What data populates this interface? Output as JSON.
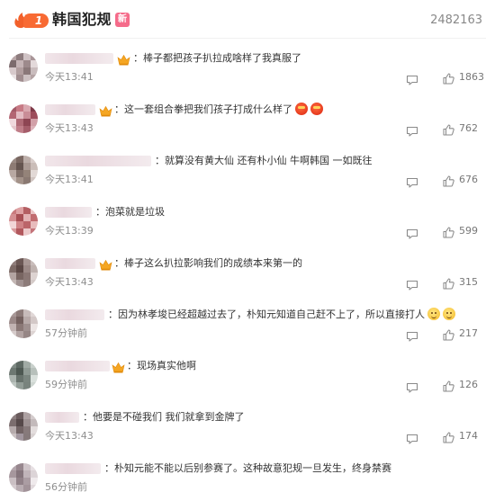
{
  "header": {
    "rank": "1",
    "title": "韩国犯规",
    "new_badge": "新",
    "hot_count": "2482163"
  },
  "comments": [
    {
      "text": "：棒子都把孩子扒拉成啥样了我真服了",
      "time": "今天13:41",
      "likes": "1863",
      "vip": true,
      "emojis": [],
      "avatar": [
        "#b9a7a8",
        "#8d7c7e",
        "#cfc2c4",
        "#a99598",
        "#7c6b6d",
        "#c4b3b5",
        "#9d8a8c",
        "#e3d9da",
        "#d7c9cb",
        "#b19e9f",
        "#8a7879",
        "#c9bcbd",
        "#ebe3e4",
        "#a08d8f",
        "#ccc0c1",
        "#b4a3a4"
      ]
    },
    {
      "text": "：这一套组合拳把我们孩子打成什么样了",
      "time": "今天13:43",
      "likes": "762",
      "vip": true,
      "emojis": [
        "red",
        "red"
      ],
      "avatar": [
        "#a35a67",
        "#c77a85",
        "#d9a8b0",
        "#7e3948",
        "#b36673",
        "#e3bcc3",
        "#c98d97",
        "#9c4c5a",
        "#f0d9dd",
        "#b06a76",
        "#8e4553",
        "#d2a0a8",
        "#e6c7cc",
        "#c07e89",
        "#a55d6a",
        "#dcb2b9"
      ]
    },
    {
      "text": "：就算没有黄大仙 还有朴小仙 牛啊韩国 一如既往",
      "time": "今天13:41",
      "likes": "676",
      "vip": false,
      "emojis": [],
      "avatar": [
        "#9a8a84",
        "#7a6862",
        "#bcaea9",
        "#d8cdca",
        "#8d7b74",
        "#655550",
        "#aa9a94",
        "#cabdb8",
        "#b8a8a2",
        "#7f6e68",
        "#948379",
        "#e2d9d6",
        "#c6b9b4",
        "#a39289",
        "#8a7972",
        "#d0c5c1"
      ]
    },
    {
      "text": "：泡菜就是垃圾",
      "time": "今天13:39",
      "likes": "599",
      "vip": false,
      "emojis": [],
      "avatar": [
        "#c97a7d",
        "#dea2a4",
        "#b45f63",
        "#eac4c5",
        "#d58f92",
        "#a84f54",
        "#e3b2b4",
        "#c16c70",
        "#f2d6d7",
        "#cf8386",
        "#bb6569",
        "#e8bcbd",
        "#d99a9c",
        "#b2585d",
        "#ecc9ca",
        "#c4747a"
      ]
    },
    {
      "text": "：棒子这么扒拉影响我们的成绩本来第一的",
      "time": "今天13:43",
      "likes": "315",
      "vip": true,
      "emojis": [],
      "avatar": [
        "#8f7d7a",
        "#6b5754",
        "#a89794",
        "#c9bdbb",
        "#7d6a66",
        "#5b4845",
        "#9b8986",
        "#bfb2af",
        "#b3a4a1",
        "#786561",
        "#8a7774",
        "#ddd3d1",
        "#c3b7b4",
        "#a09190",
        "#8c7b79",
        "#d4cac8"
      ]
    },
    {
      "text": "：因为林孝埈已经超越过去了，朴知元知道自己赶不上了，所以直接打人",
      "time": "57分钟前",
      "likes": "217",
      "vip": false,
      "emojis": [
        "yellow",
        "yellow"
      ],
      "avatar": [
        "#a89897",
        "#8d7b79",
        "#c7bbba",
        "#e0d7d6",
        "#9b8988",
        "#74615f",
        "#b8aaa9",
        "#d3c8c7",
        "#c1b3b2",
        "#8a7876",
        "#a09190",
        "#ece5e4",
        "#d6cccb",
        "#b2a3a2",
        "#968685",
        "#ddd4d3"
      ]
    },
    {
      "text": "：现场真实他啊",
      "time": "59分钟前",
      "likes": "126",
      "vip": true,
      "emojis": [],
      "avatar": [
        "#7f8a84",
        "#5e6963",
        "#a1aba5",
        "#c8d0cb",
        "#6d7872",
        "#4d5852",
        "#8f9a94",
        "#b7c0bb",
        "#aab3ae",
        "#67726c",
        "#7a857f",
        "#d9e0dc",
        "#bcc5c0",
        "#929d97",
        "#78837d",
        "#cdd5d0"
      ]
    },
    {
      "text": "：他要是不碰我们 我们就拿到金牌了",
      "time": "今天13:43",
      "likes": "174",
      "vip": false,
      "emojis": [],
      "avatar": [
        "#8c7f80",
        "#6a5c5d",
        "#ada1a2",
        "#d3cbcc",
        "#7b6d6e",
        "#56494a",
        "#9d9192",
        "#c3babb",
        "#b6abac",
        "#716364",
        "#877a7b",
        "#e3dddd",
        "#cac1c2",
        "#a2979f",
        "#85797a",
        "#d8d1d1"
      ]
    },
    {
      "text": "：朴知元能不能以后别参赛了。这种故意犯规一旦发生，终身禁赛",
      "time": "56分钟前",
      "likes": "",
      "vip": false,
      "emojis": [],
      "avatar": [
        "#b4a7ad",
        "#97878e",
        "#cfc5c9",
        "#e6dfe2",
        "#a6979d",
        "#85757c",
        "#c0b4b9",
        "#dcd4d7",
        "#cabfc3",
        "#918188",
        "#ab9da3",
        "#efeaec",
        "#d5cbcf",
        "#b9adb2",
        "#a29399",
        "#e1d9dc"
      ]
    }
  ]
}
